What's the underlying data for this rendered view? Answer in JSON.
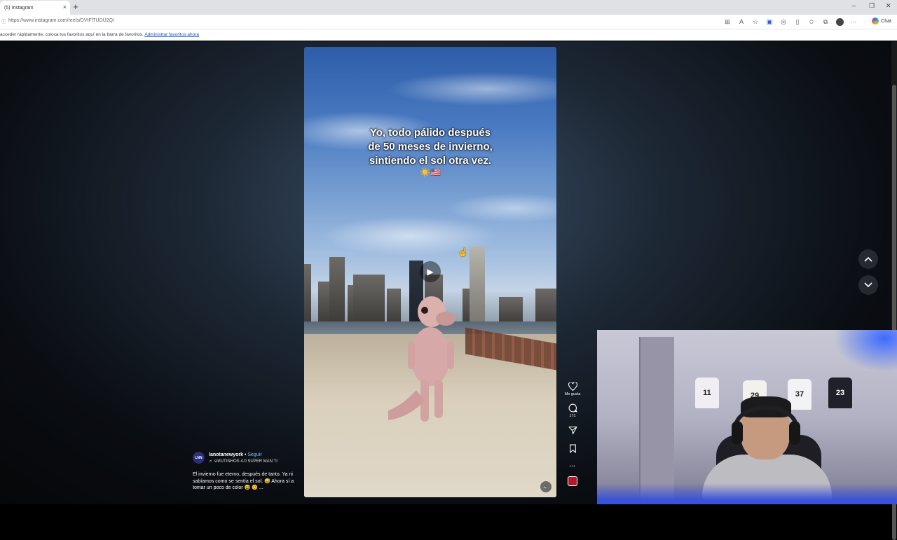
{
  "browser": {
    "tab_title": "(5) Instagram",
    "tab_close": "×",
    "new_tab": "+",
    "url": "https://www.instagram.com/reels/DVtFlTUDU2Q/",
    "favorites_text": "acceder rápidamente, coloca tus favoritos aquí en la barra de favoritos.",
    "favorites_link": "Administrar favoritos ahora",
    "copilot_label": "Chat",
    "window_controls": [
      "–",
      "❐",
      "✕"
    ]
  },
  "reel": {
    "caption_lines": [
      "Yo, todo pálido después",
      "de 50 meses de invierno,",
      "sintiendo el sol otra vez."
    ],
    "caption_emoji": "☀️🇺🇸",
    "play_icon": "▶",
    "mute_icon": "🔈"
  },
  "actions": {
    "like_label": "Me gusta",
    "comments_count": "171",
    "more_icon": "···"
  },
  "post": {
    "avatar_text": "LNN",
    "username": "lanotanewyork",
    "separator": " • ",
    "follow": "Seguir",
    "audio_icon": "♬",
    "audio": "ѕIИUTINHOS 4.0 SUPER MAN TI",
    "description": "El invierno fue eterno, después de tanto. Ya ni sabíamos como se sentía el sol. 😅 Ahora sí a tomar un poco de color 😅 😊 ..."
  },
  "navigation": {
    "up_icon": "chevron-up",
    "down_icon": "chevron-down"
  },
  "webcam": {
    "jerseys": [
      "11",
      "29",
      "37",
      "23"
    ]
  }
}
